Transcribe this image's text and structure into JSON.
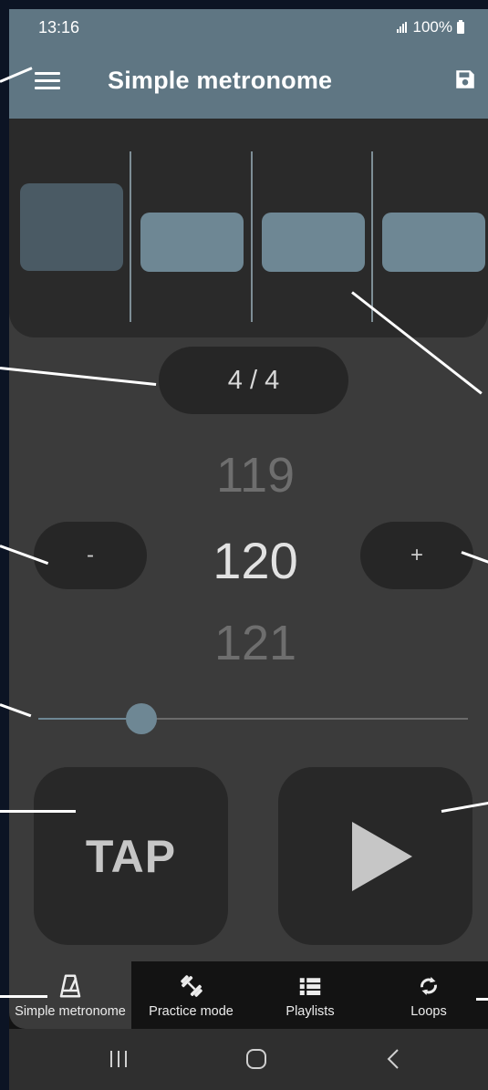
{
  "status_bar": {
    "time": "13:16",
    "battery": "100%"
  },
  "app_bar": {
    "title": "Simple metronome"
  },
  "time_signature": "4 / 4",
  "bpm": {
    "previous": "119",
    "current": "120",
    "next": "121"
  },
  "buttons": {
    "decrease_label": "-",
    "increase_label": "+",
    "tap_label": "TAP"
  },
  "beats": [
    {
      "accent": true
    },
    {
      "accent": false
    },
    {
      "accent": false
    },
    {
      "accent": false
    }
  ],
  "tempo_slider": {
    "value": 120,
    "fill_fraction": 0.24
  },
  "bottom_nav": {
    "items": [
      {
        "label": "Simple metronome",
        "icon": "metronome-icon",
        "active": true
      },
      {
        "label": "Practice mode",
        "icon": "dumbbell-icon",
        "active": false
      },
      {
        "label": "Playlists",
        "icon": "list-icon",
        "active": false
      },
      {
        "label": "Loops",
        "icon": "loop-icon",
        "active": false
      }
    ]
  },
  "colors": {
    "accent": "#5f7683",
    "beat_normal": "#6e8794",
    "beat_accent": "#4a5a64",
    "background": "#3b3b3b",
    "panel": "#2a2a2a"
  }
}
